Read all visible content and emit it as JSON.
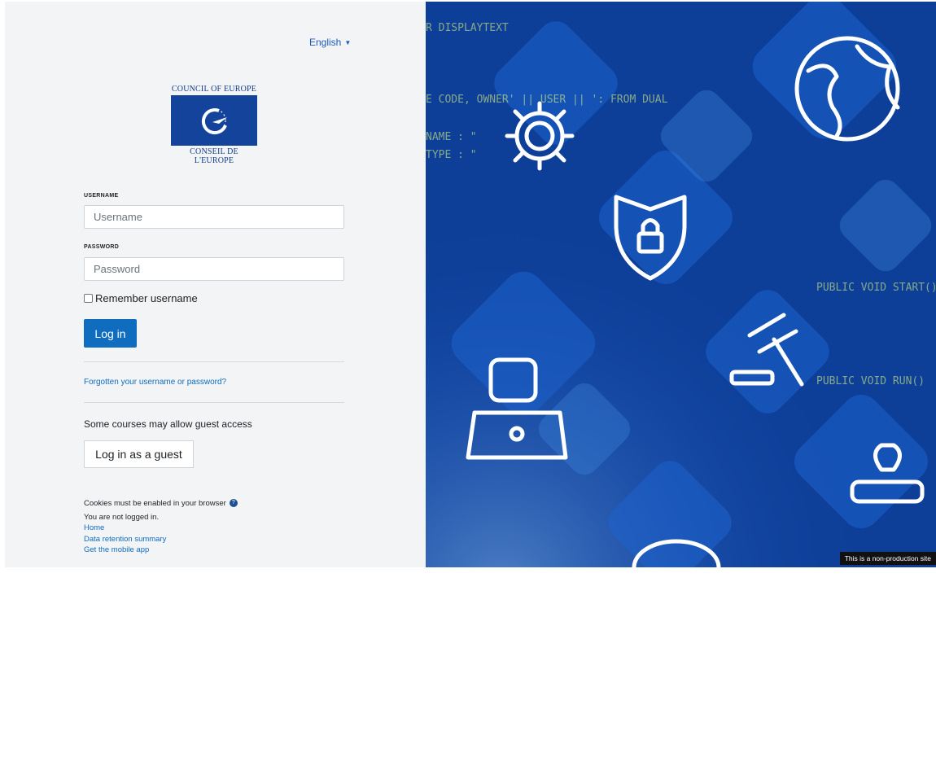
{
  "language": {
    "label": "English"
  },
  "logo": {
    "top_text": "COUNCIL OF EUROPE",
    "bottom_text": "CONSEIL DE L'EUROPE"
  },
  "form": {
    "username_label": "USERNAME",
    "username_placeholder": "Username",
    "password_label": "PASSWORD",
    "password_placeholder": "Password",
    "remember_label": "Remember username",
    "login_button": "Log in",
    "forgot_link": "Forgotten your username or password?",
    "guest_text": "Some courses may allow guest access",
    "guest_button": "Log in as a guest"
  },
  "footer": {
    "cookies_text": "Cookies must be enabled in your browser",
    "not_logged_in": "You are not logged in.",
    "home_link": "Home",
    "retention_link": "Data retention summary",
    "mobile_link": "Get the mobile app"
  },
  "banner": {
    "text": "This is a non-production site"
  },
  "colors": {
    "accent": "#0f6cbf",
    "background": "#f3f4f6",
    "hero_blue": "#0d3f99"
  }
}
